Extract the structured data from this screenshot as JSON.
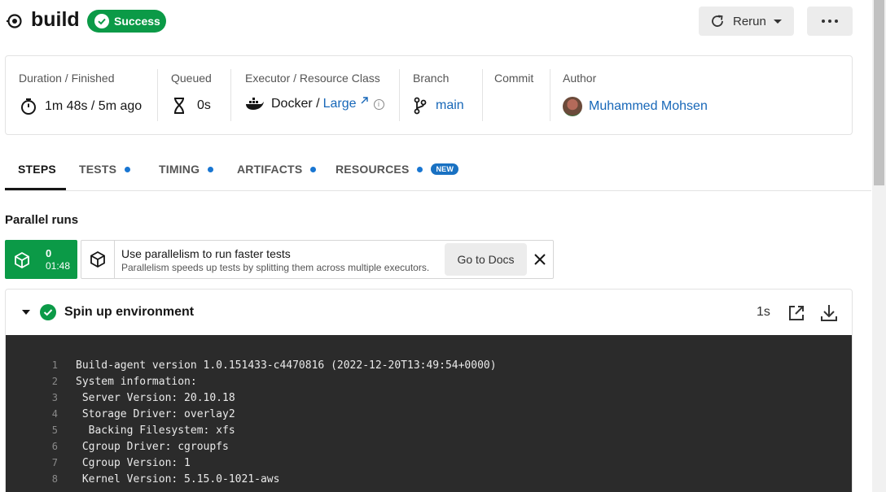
{
  "header": {
    "job_name": "build",
    "status": "Success",
    "rerun_label": "Rerun"
  },
  "info": {
    "duration_label": "Duration / Finished",
    "duration_value": "1m 48s / 5m ago",
    "queued_label": "Queued",
    "queued_value": "0s",
    "executor_label": "Executor / Resource Class",
    "executor_value": "Docker /",
    "resource_class": "Large",
    "branch_label": "Branch",
    "branch_value": "main",
    "commit_label": "Commit",
    "author_label": "Author",
    "author_value": "Muhammed Mohsen"
  },
  "tabs": [
    {
      "label": "STEPS",
      "active": true
    },
    {
      "label": "TESTS",
      "dot": true
    },
    {
      "label": "TIMING",
      "dot": true
    },
    {
      "label": "ARTIFACTS",
      "dot": true
    },
    {
      "label": "RESOURCES",
      "dot": true,
      "badge": "NEW"
    }
  ],
  "parallel": {
    "title": "Parallel runs",
    "run_index": "0",
    "run_time": "01:48",
    "promo_title": "Use parallelism to run faster tests",
    "promo_subtitle": "Parallelism speeds up tests by splitting them across multiple executors.",
    "docs_button": "Go to Docs"
  },
  "step": {
    "title": "Spin up environment",
    "duration": "1s",
    "lines": [
      {
        "n": "1",
        "text": "Build-agent version 1.0.151433-c4470816 (2022-12-20T13:49:54+0000)"
      },
      {
        "n": "2",
        "text": "System information:"
      },
      {
        "n": "3",
        "text": " Server Version: 20.10.18"
      },
      {
        "n": "4",
        "text": " Storage Driver: overlay2"
      },
      {
        "n": "5",
        "text": "  Backing Filesystem: xfs"
      },
      {
        "n": "6",
        "text": " Cgroup Driver: cgroupfs"
      },
      {
        "n": "7",
        "text": " Cgroup Version: 1"
      },
      {
        "n": "8",
        "text": " Kernel Version: 5.15.0-1021-aws"
      }
    ]
  },
  "colors": {
    "success": "#0b9a47",
    "link": "#1767b8",
    "accent_dot": "#1976d2",
    "console_bg": "#2b2b2b"
  }
}
